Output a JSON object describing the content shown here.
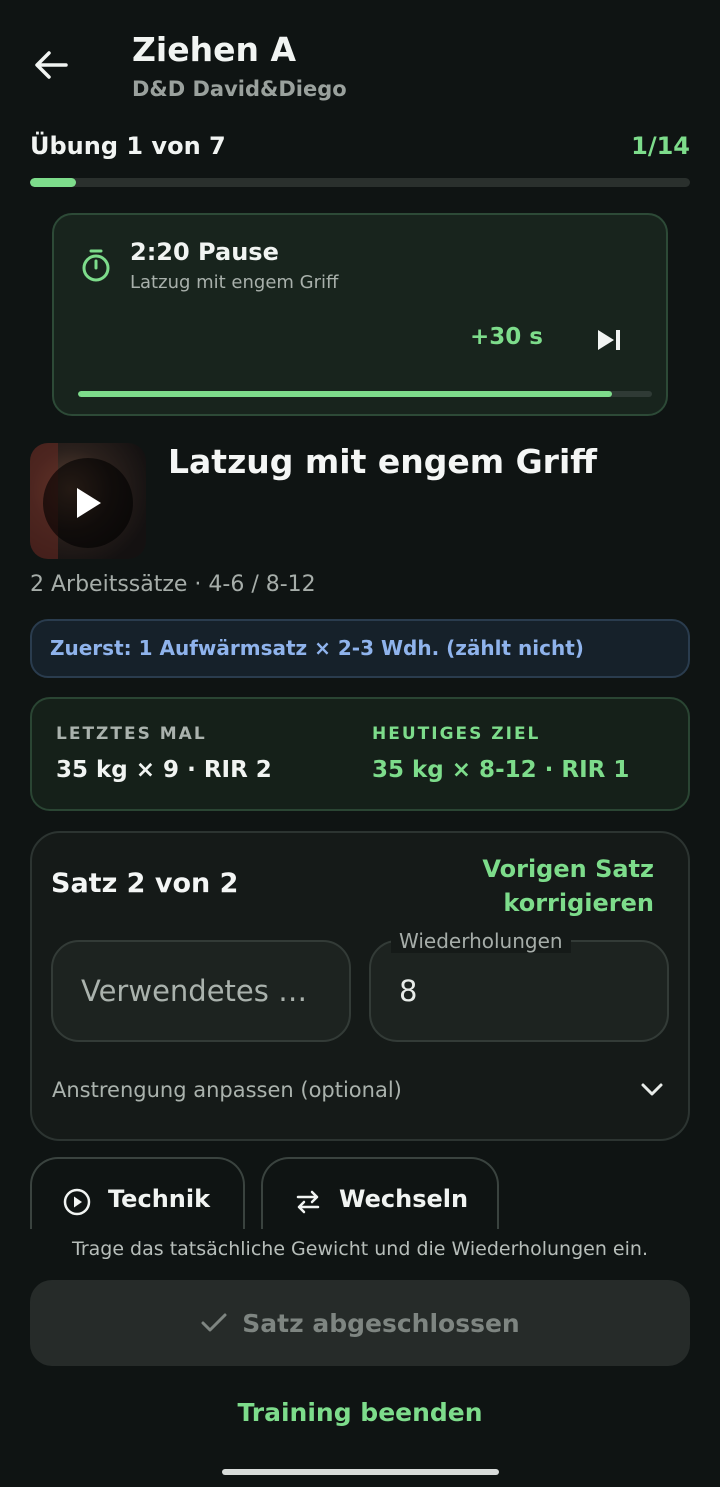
{
  "header": {
    "title": "Ziehen A",
    "subtitle": "D&D David&Diego",
    "exercise_progress": "Übung 1 von 7",
    "set_count": "1/14",
    "progress_fraction": 0.07
  },
  "timer": {
    "title": "2:20 Pause",
    "exercise": "Latzug mit engem Griff",
    "add_time": "+30 s",
    "progress_fraction": 0.93
  },
  "exercise": {
    "name": "Latzug mit engem Griff",
    "meta": "2 Arbeitssätze · 4-6 / 8-12",
    "warmup": "Zuerst: 1 Aufwärmsatz × 2-3 Wdh. (zählt nicht)"
  },
  "comparison": {
    "last_heading": "LETZTES MAL",
    "last_value": "35 kg × 9 · RIR 2",
    "goal_heading": "HEUTIGES ZIEL",
    "goal_value": "35 kg × 8-12 · RIR 1"
  },
  "set": {
    "title": "Satz 2 von 2",
    "prev_fix_line1": "Vorigen Satz",
    "prev_fix_line2": "korrigieren",
    "weight_placeholder": "Verwendetes …",
    "reps_label": "Wiederholungen",
    "reps_value": "8",
    "effort_label": "Anstrengung anpassen (optional)"
  },
  "actions": {
    "technique": "Technik",
    "switch": "Wechseln",
    "hint": "Trage das tatsächliche Gewicht und die Wiederholungen ein.",
    "complete": "Satz abgeschlossen",
    "end": "Training beenden"
  },
  "colors": {
    "accent": "#7ddc8b",
    "background": "#0f1413",
    "info": "#8fb3ec"
  }
}
